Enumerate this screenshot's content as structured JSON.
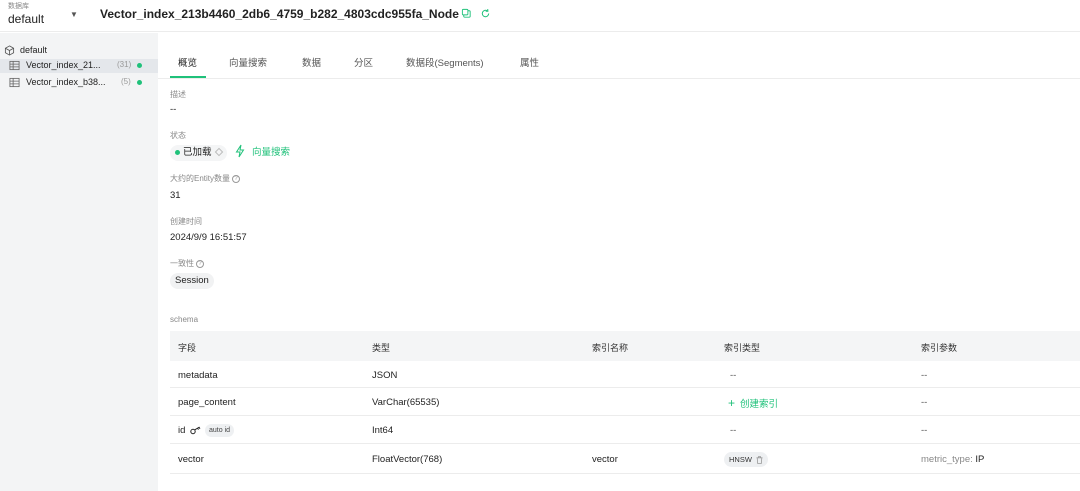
{
  "topbar": {
    "db_label": "数据库",
    "db_value": "default",
    "collection_title": "Vector_index_213b4460_2db6_4759_b282_4803cdc955fa_Node"
  },
  "sidebar": {
    "database": "default",
    "collections": [
      {
        "name": "Vector_index_21...",
        "count": "(31)",
        "status": "loaded"
      },
      {
        "name": "Vector_index_b38...",
        "count": "(5)",
        "status": "loaded"
      }
    ]
  },
  "tabs": [
    {
      "label": "概览",
      "active": true
    },
    {
      "label": "向量搜索"
    },
    {
      "label": "数据"
    },
    {
      "label": "分区"
    },
    {
      "label": "数据段(Segments)"
    },
    {
      "label": "属性"
    }
  ],
  "overview": {
    "description_label": "描述",
    "description_value": "--",
    "status_label": "状态",
    "status_value": "已加载",
    "vector_search_link": "向量搜索",
    "entity_count_label": "大约的Entity数量",
    "entity_count_value": "31",
    "created_label": "创建时间",
    "created_value": "2024/9/9 16:51:57",
    "consistency_label": "一致性",
    "consistency_value": "Session"
  },
  "schema": {
    "label": "schema",
    "headers": [
      "字段",
      "类型",
      "索引名称",
      "索引类型",
      "索引参数"
    ],
    "rows": [
      {
        "field": "metadata",
        "type": "JSON",
        "index_name": "",
        "index_type": "--",
        "index_params": "--"
      },
      {
        "field": "page_content",
        "type": "VarChar(65535)",
        "index_name": "",
        "index_type": "创建索引",
        "index_params": "--"
      },
      {
        "field": "id",
        "badge": "auto id",
        "type": "Int64",
        "index_name": "",
        "index_type": "--",
        "index_params": "--"
      },
      {
        "field": "vector",
        "type": "FloatVector(768)",
        "index_name": "vector",
        "index_type": "HNSW",
        "index_params_key": "metric_type:",
        "index_params_value": "IP"
      }
    ]
  },
  "colors": {
    "accent": "#1fc17a",
    "sidebar_bg": "#f3f4f5",
    "table_header_bg": "#f4f5f6"
  },
  "icons": [
    "copy-icon",
    "refresh-icon",
    "database-icon",
    "table-icon",
    "bolt-icon",
    "key-icon",
    "trash-icon",
    "plus-icon",
    "help-icon",
    "chevron-down-icon"
  ]
}
